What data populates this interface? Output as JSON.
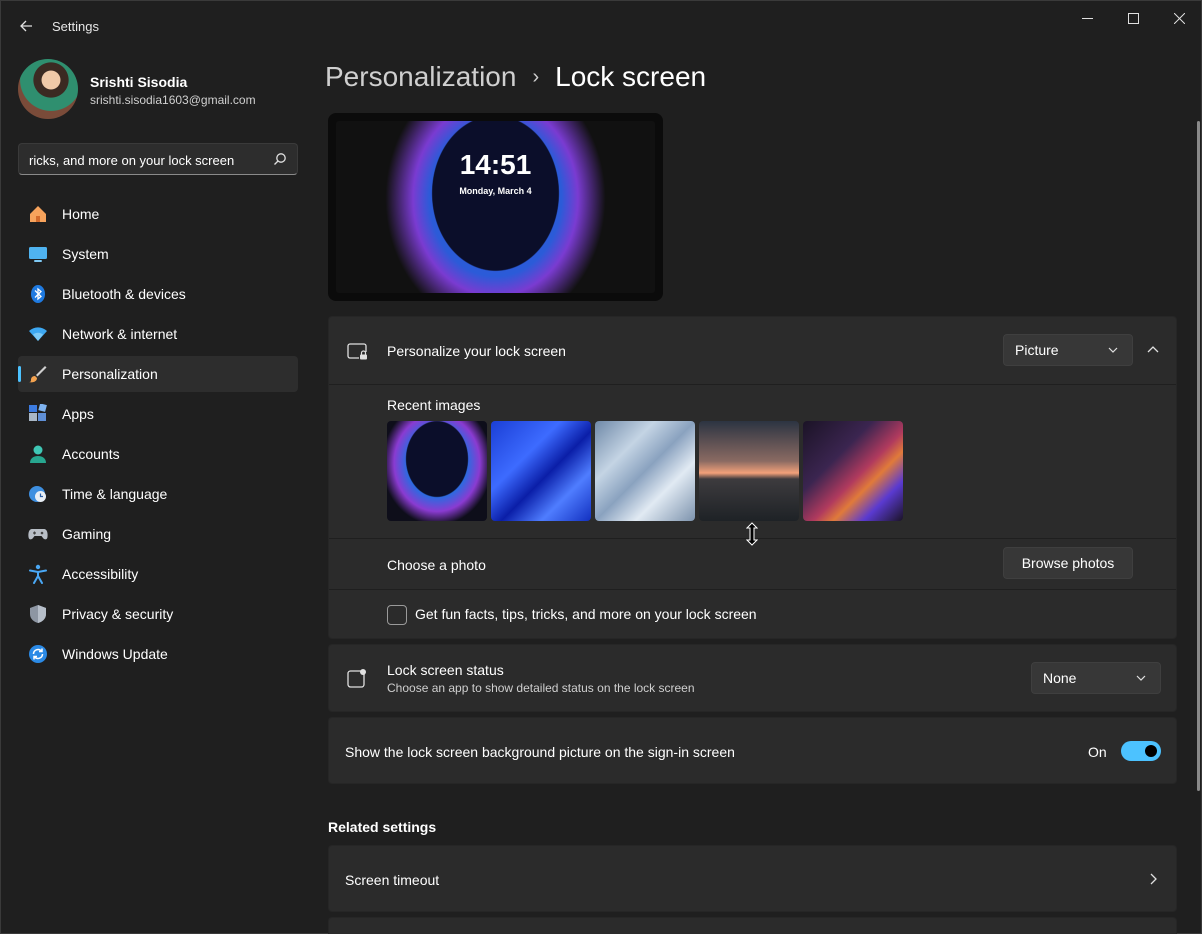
{
  "window": {
    "title": "Settings"
  },
  "profile": {
    "name": "Srishti Sisodia",
    "email": "srishti.sisodia1603@gmail.com"
  },
  "search": {
    "value": "ricks, and more on your lock screen"
  },
  "sidebar": {
    "items": [
      {
        "label": "Home",
        "icon": "home-icon"
      },
      {
        "label": "System",
        "icon": "monitor-icon"
      },
      {
        "label": "Bluetooth & devices",
        "icon": "bluetooth-icon"
      },
      {
        "label": "Network & internet",
        "icon": "wifi-icon"
      },
      {
        "label": "Personalization",
        "icon": "brush-icon",
        "active": true
      },
      {
        "label": "Apps",
        "icon": "apps-icon"
      },
      {
        "label": "Accounts",
        "icon": "person-icon"
      },
      {
        "label": "Time & language",
        "icon": "clock-globe-icon"
      },
      {
        "label": "Gaming",
        "icon": "gamepad-icon"
      },
      {
        "label": "Accessibility",
        "icon": "accessibility-icon"
      },
      {
        "label": "Privacy & security",
        "icon": "shield-icon"
      },
      {
        "label": "Windows Update",
        "icon": "update-icon"
      }
    ]
  },
  "breadcrumb": {
    "parent": "Personalization",
    "separator": "›",
    "current": "Lock screen"
  },
  "preview": {
    "time": "14:51",
    "date": "Monday, March 4"
  },
  "personalize": {
    "label": "Personalize your lock screen",
    "dropdown_value": "Picture",
    "recent_images_label": "Recent images",
    "choose_photo_label": "Choose a photo",
    "browse_button": "Browse photos",
    "fun_facts_label": "Get fun facts, tips, tricks, and more on your lock screen"
  },
  "status": {
    "label": "Lock screen status",
    "description": "Choose an app to show detailed status on the lock screen",
    "dropdown_value": "None"
  },
  "signin": {
    "label": "Show the lock screen background picture on the sign-in screen",
    "toggle_text": "On",
    "toggle_on": true
  },
  "related": {
    "title": "Related settings",
    "screen_timeout": "Screen timeout"
  },
  "colors": {
    "accent": "#4cc2ff"
  }
}
